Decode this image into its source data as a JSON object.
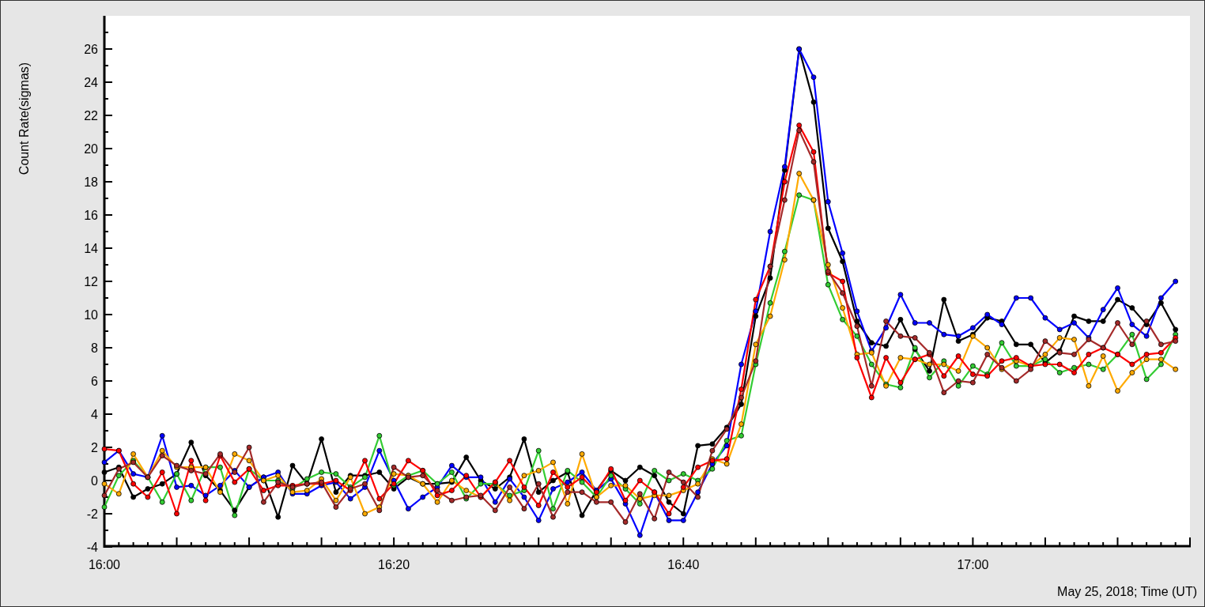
{
  "chart_data": {
    "type": "line",
    "xlabel": "May 25, 2018; Time (UT)",
    "ylabel": "Count Rate(sigmas)",
    "categories": [
      "16:00",
      null,
      null,
      null,
      null,
      null,
      null,
      null,
      null,
      null,
      null,
      null,
      null,
      null,
      null,
      null,
      null,
      null,
      null,
      null,
      "16:20",
      null,
      null,
      null,
      null,
      null,
      null,
      null,
      null,
      null,
      null,
      null,
      null,
      null,
      null,
      null,
      null,
      null,
      null,
      null,
      "16:40",
      null,
      null,
      null,
      null,
      null,
      null,
      null,
      null,
      null,
      null,
      null,
      null,
      null,
      null,
      null,
      null,
      null,
      null,
      null,
      "17:00",
      null,
      null,
      null,
      null,
      null,
      null,
      null,
      null,
      null,
      null,
      null,
      null,
      null,
      null
    ],
    "ylim": [
      -4,
      28
    ],
    "yticks": [
      -4,
      -2,
      0,
      2,
      4,
      6,
      8,
      10,
      12,
      14,
      16,
      18,
      20,
      22,
      24,
      26
    ],
    "series": [
      {
        "color": "#000000",
        "marker": "circle",
        "values": [
          0.5,
          0.8,
          -1.0,
          -0.5,
          -0.2,
          0.4,
          2.3,
          0.3,
          -0.6,
          -1.8,
          -0.4,
          0.2,
          -2.2,
          0.9,
          -0.2,
          2.5,
          -0.7,
          0.3,
          0.3,
          0.5,
          -0.5,
          0.2,
          -0.2,
          -0.2,
          -0.1,
          1.4,
          0.0,
          -0.5,
          0.2,
          2.5,
          -0.7,
          0.0,
          0.5,
          -2.1,
          -0.6,
          0.6,
          0.0,
          0.8,
          0.3,
          -1.3,
          -2.0,
          2.1,
          2.2,
          3.2,
          4.6,
          9.9,
          12.2,
          18.7,
          26.0,
          22.8,
          15.2,
          13.2,
          9.6,
          8.3,
          8.1,
          9.7,
          7.9,
          6.6,
          10.9,
          8.4,
          8.8,
          9.8,
          9.6,
          8.2,
          8.2,
          7.1,
          7.8,
          9.9,
          9.6,
          9.6,
          10.9,
          10.4,
          9.4,
          10.7,
          9.1
        ]
      },
      {
        "color": "#0000ff",
        "marker": "circle",
        "values": [
          1.1,
          1.8,
          0.4,
          0.2,
          2.7,
          -0.4,
          -0.3,
          -0.9,
          -0.3,
          0.6,
          -0.4,
          0.2,
          0.5,
          -0.8,
          -0.8,
          -0.3,
          -0.1,
          -1.1,
          -0.4,
          1.8,
          0.0,
          -1.7,
          -1.0,
          -0.4,
          0.9,
          0.2,
          0.2,
          -1.3,
          0.1,
          -1.0,
          -2.4,
          -0.5,
          -0.1,
          0.5,
          -0.6,
          0.1,
          -1.4,
          -3.3,
          -0.7,
          -2.4,
          -2.4,
          -0.7,
          1.0,
          2.1,
          7.0,
          10.2,
          15.0,
          18.9,
          26.0,
          24.3,
          16.8,
          13.7,
          10.2,
          7.8,
          9.2,
          11.2,
          9.5,
          9.5,
          8.8,
          8.7,
          9.2,
          10.0,
          9.4,
          11.0,
          11.0,
          9.8,
          9.1,
          9.5,
          8.6,
          10.3,
          11.6,
          9.4,
          8.7,
          11.0,
          12.0
        ]
      },
      {
        "color": "#33cc33",
        "marker": "circle",
        "values": [
          -1.6,
          0.3,
          1.2,
          0.2,
          -1.3,
          0.4,
          -1.2,
          0.8,
          0.8,
          -2.1,
          0.7,
          0.0,
          0.0,
          -0.5,
          0.1,
          0.5,
          0.4,
          -0.4,
          0.2,
          2.7,
          -0.3,
          0.3,
          0.6,
          -0.2,
          0.5,
          -1.1,
          -0.2,
          -0.2,
          -0.9,
          -0.6,
          1.8,
          -1.7,
          0.6,
          -0.1,
          -1.0,
          0.3,
          -0.5,
          -1.4,
          0.6,
          0.0,
          0.4,
          0.0,
          0.7,
          2.4,
          2.7,
          7.0,
          10.7,
          13.8,
          17.2,
          16.9,
          11.8,
          9.7,
          8.7,
          7.0,
          5.8,
          5.6,
          8.0,
          6.2,
          7.2,
          5.7,
          6.9,
          6.4,
          8.3,
          6.9,
          6.9,
          7.3,
          6.5,
          6.8,
          7.0,
          6.7,
          7.6,
          8.8,
          6.1,
          7.0,
          8.8
        ]
      },
      {
        "color": "#ffaa00",
        "marker": "circle",
        "values": [
          -0.2,
          -0.8,
          1.6,
          0.2,
          1.8,
          0.8,
          0.8,
          0.8,
          -0.7,
          1.6,
          1.2,
          0.0,
          0.3,
          -0.7,
          -0.6,
          0.1,
          -1.2,
          0.2,
          -2.0,
          -1.6,
          0.4,
          0.3,
          -0.2,
          -1.3,
          0.0,
          -0.6,
          -1.0,
          -0.1,
          -1.2,
          0.3,
          0.6,
          1.1,
          -1.4,
          1.6,
          -1.0,
          -0.3,
          -0.3,
          -1.1,
          -0.9,
          -0.9,
          -0.6,
          -0.2,
          1.3,
          1.0,
          3.4,
          8.2,
          9.9,
          13.3,
          18.5,
          16.9,
          13.0,
          10.4,
          7.6,
          7.7,
          5.7,
          7.4,
          7.3,
          7.0,
          7.0,
          6.6,
          8.7,
          8.0,
          6.7,
          7.2,
          6.9,
          7.6,
          8.6,
          8.5,
          5.7,
          7.5,
          5.4,
          6.5,
          7.3,
          7.3,
          6.7
        ]
      },
      {
        "color": "#ff0000",
        "marker": "circle",
        "values": [
          1.9,
          1.8,
          -0.2,
          -1.0,
          0.5,
          -2.0,
          1.2,
          -1.2,
          1.5,
          -0.1,
          0.7,
          -0.6,
          -0.3,
          -0.3,
          -0.2,
          -0.2,
          0.0,
          -0.6,
          1.2,
          -1.1,
          -0.2,
          1.2,
          0.6,
          -0.9,
          -0.6,
          0.3,
          -1.0,
          -0.1,
          1.2,
          -0.4,
          -1.5,
          0.5,
          -0.4,
          0.2,
          -0.7,
          0.7,
          -1.2,
          0.0,
          -0.7,
          -2.0,
          -0.4,
          0.8,
          1.2,
          1.3,
          5.5,
          10.9,
          12.9,
          18.0,
          21.4,
          19.8,
          12.5,
          12.0,
          7.4,
          5.0,
          7.4,
          5.9,
          7.3,
          7.6,
          6.3,
          7.5,
          6.4,
          6.3,
          7.2,
          7.4,
          6.9,
          7.0,
          7.0,
          6.5,
          7.6,
          8.0,
          7.6,
          7.0,
          7.6,
          7.7,
          8.6
        ]
      },
      {
        "color": "#a52a2a",
        "marker": "circle",
        "values": [
          -0.9,
          0.7,
          1.1,
          0.2,
          1.5,
          0.9,
          0.6,
          0.4,
          1.6,
          0.5,
          2.0,
          -1.3,
          -0.1,
          -0.4,
          -0.2,
          -0.1,
          -1.6,
          -0.5,
          -0.2,
          -1.8,
          0.8,
          0.2,
          0.3,
          -0.6,
          -1.2,
          -1.0,
          -0.9,
          -1.8,
          -0.4,
          -1.7,
          -0.2,
          -2.2,
          -0.7,
          -0.7,
          -1.3,
          -1.3,
          -2.5,
          -0.8,
          -2.3,
          0.5,
          -0.1,
          -1.0,
          1.8,
          3.1,
          5.0,
          7.2,
          12.9,
          16.9,
          21.1,
          19.2,
          12.6,
          11.3,
          9.3,
          5.7,
          9.6,
          8.7,
          8.6,
          7.7,
          5.3,
          6.0,
          5.9,
          7.6,
          6.8,
          6.0,
          6.7,
          8.4,
          7.7,
          7.6,
          8.5,
          8.0,
          9.5,
          8.2,
          9.6,
          8.2,
          8.4
        ]
      }
    ]
  }
}
